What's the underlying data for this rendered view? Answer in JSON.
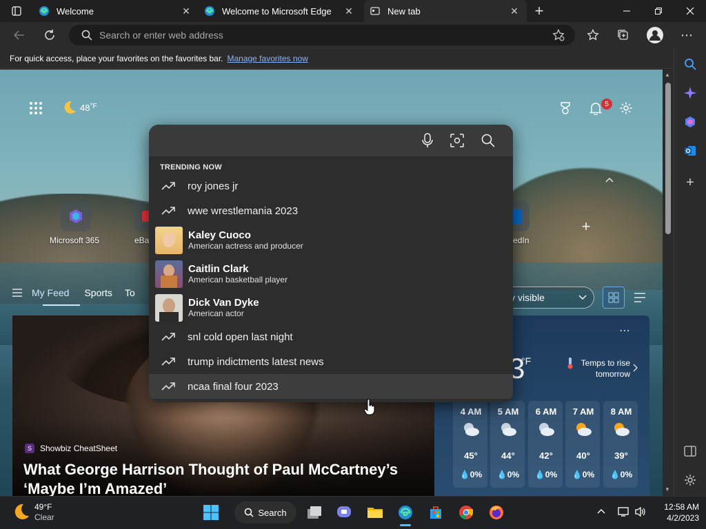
{
  "tabs": [
    {
      "title": "Welcome"
    },
    {
      "title": "Welcome to Microsoft Edge"
    },
    {
      "title": "New tab"
    }
  ],
  "address": {
    "placeholder": "Search or enter web address"
  },
  "favbar": {
    "text": "For quick access, place your favorites on the favorites bar.",
    "link": "Manage favorites now"
  },
  "ntp": {
    "weather_temp": "48",
    "weather_unit": "°F",
    "notifications_count": "5",
    "quick_links": [
      {
        "label": "Microsoft 365"
      },
      {
        "label": "eBay"
      },
      {
        "label": "LinkedIn"
      }
    ],
    "feed_tabs": [
      "My Feed",
      "Sports",
      "To"
    ],
    "visibility_label": "ly visible"
  },
  "search": {
    "header": "TRENDING NOW",
    "items": [
      {
        "type": "trend",
        "text": "roy jones jr"
      },
      {
        "type": "trend",
        "text": "wwe wrestlemania 2023"
      },
      {
        "type": "person",
        "name": "Kaley Cuoco",
        "desc": "American actress and producer"
      },
      {
        "type": "person",
        "name": "Caitlin Clark",
        "desc": "American basketball player"
      },
      {
        "type": "person",
        "name": "Dick Van Dyke",
        "desc": "American actor"
      },
      {
        "type": "trend",
        "text": "snl cold open last night"
      },
      {
        "type": "trend",
        "text": "trump indictments latest news"
      },
      {
        "type": "trend",
        "text": "ncaa final four 2023"
      }
    ]
  },
  "article": {
    "source": "Showbiz CheatSheet",
    "headline": "What George Harrison Thought of Paul McCartney’s ‘Maybe I’m Amazed’"
  },
  "weather_card": {
    "current_digit": "3",
    "unit": "°F",
    "forecast_note": "Temps to rise tomorrow",
    "hours": [
      {
        "time": "4 AM",
        "temp": "45°",
        "precip": "0%"
      },
      {
        "time": "5 AM",
        "temp": "44°",
        "precip": "0%"
      },
      {
        "time": "6 AM",
        "temp": "42°",
        "precip": "0%"
      },
      {
        "time": "7 AM",
        "temp": "40°",
        "precip": "0%"
      },
      {
        "time": "8 AM",
        "temp": "39°",
        "precip": "0%"
      }
    ]
  },
  "taskbar": {
    "weather_temp": "49°F",
    "weather_cond": "Clear",
    "search_label": "Search",
    "time": "12:58 AM",
    "date": "4/2/2023"
  },
  "colors": {
    "accent": "#0078d4",
    "badge": "#d13438",
    "link": "#8ab4f8"
  }
}
